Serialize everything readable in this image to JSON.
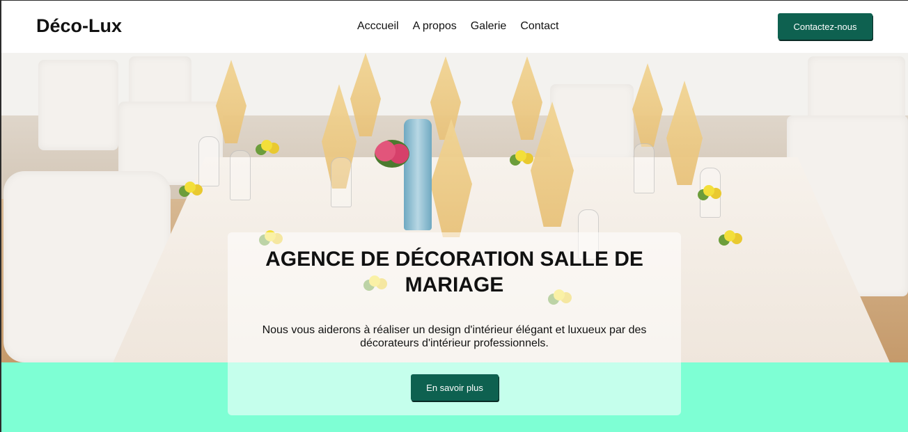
{
  "header": {
    "logo": "Déco-Lux",
    "nav": [
      "Acccueil",
      "A propos",
      "Galerie",
      "Contact"
    ],
    "cta_label": "Contactez-nous"
  },
  "hero": {
    "image_description_icon": "wedding-table-photo",
    "title": "AGENCE DE DÉCORATION SALLE DE MARIAGE",
    "subtitle": "Nous vous aiderons à réaliser un design d'intérieur élégant et luxueux par des décorateurs d'intérieur professionnels.",
    "cta_label": "En savoir plus"
  },
  "colors": {
    "accent": "#0e6150",
    "section_bg": "#7effd4"
  }
}
